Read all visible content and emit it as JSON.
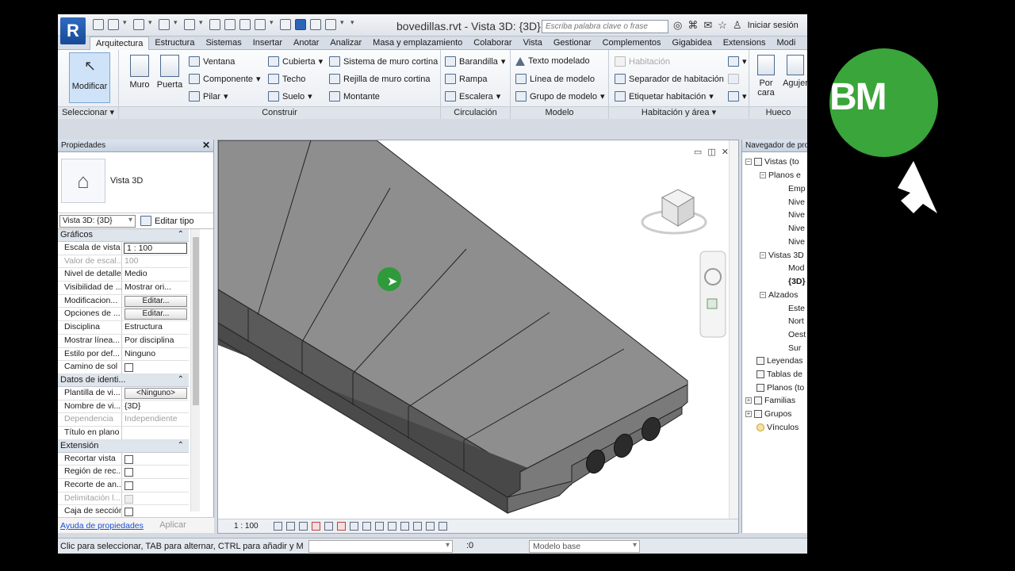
{
  "window": {
    "title": "bovedillas.rvt - Vista 3D: {3D}",
    "search_placeholder": "Escriba palabra clave o frase",
    "sign_in": "Iniciar sesión"
  },
  "tabs": [
    "Arquitectura",
    "Estructura",
    "Sistemas",
    "Insertar",
    "Anotar",
    "Analizar",
    "Masa y emplazamiento",
    "Colaborar",
    "Vista",
    "Gestionar",
    "Complementos",
    "Gigabidea",
    "Extensions",
    "Modi"
  ],
  "ribbon": {
    "select": {
      "modify": "Modificar",
      "label": "Seleccionar ▾"
    },
    "build": {
      "label": "Construir",
      "wall": "Muro",
      "door": "Puerta",
      "window": "Ventana",
      "component": "Componente",
      "column": "Pilar",
      "roof": "Cubierta",
      "ceiling": "Techo",
      "floor": "Suelo",
      "curtain_system": "Sistema de muro cortina",
      "curtain_grid": "Rejilla de muro cortina",
      "mullion": "Montante"
    },
    "circulation": {
      "label": "Circulación",
      "railing": "Barandilla",
      "ramp": "Rampa",
      "stair": "Escalera"
    },
    "model": {
      "label": "Modelo",
      "model_text": "Texto modelado",
      "model_line": "Línea de modelo",
      "model_group": "Grupo de modelo"
    },
    "room_area": {
      "label": "Habitación y área ▾",
      "room": "Habitación",
      "separator": "Separador de habitación",
      "tag": "Etiquetar habitación"
    },
    "opening": {
      "label": "Hueco",
      "by_face_1": "Por",
      "by_face_2": "cara",
      "shaft": "Agujer"
    }
  },
  "properties": {
    "header": "Propiedades",
    "type_name": "Vista 3D",
    "view_selector": "Vista 3D: {3D}",
    "edit_type": "Editar tipo",
    "categories": {
      "graphics": "Gráficos",
      "identity": "Datos de identi...",
      "extents": "Extensión"
    },
    "graphics_rows": [
      {
        "key": "Escala de vista",
        "value": "1 : 100"
      },
      {
        "key": "Valor de escal...",
        "value": "100"
      },
      {
        "key": "Nivel de detalle",
        "value": "Medio"
      },
      {
        "key": "Visibilidad de ...",
        "value": "Mostrar ori..."
      },
      {
        "key": "Modificacion...",
        "value": "Editar..."
      },
      {
        "key": "Opciones de ...",
        "value": "Editar..."
      },
      {
        "key": "Disciplina",
        "value": "Estructura"
      },
      {
        "key": "Mostrar línea...",
        "value": "Por disciplina"
      },
      {
        "key": "Estilo por def...",
        "value": "Ninguno"
      },
      {
        "key": "Camino de sol",
        "value": ""
      }
    ],
    "identity_rows": [
      {
        "key": "Plantilla de vi...",
        "value": "<Ninguno>"
      },
      {
        "key": "Nombre de vi...",
        "value": "{3D}"
      },
      {
        "key": "Dependencia",
        "value": "Independiente"
      },
      {
        "key": "Título en plano",
        "value": ""
      }
    ],
    "extents_rows": [
      {
        "key": "Recortar vista",
        "value": ""
      },
      {
        "key": "Región de rec...",
        "value": ""
      },
      {
        "key": "Recorte de an...",
        "value": ""
      },
      {
        "key": "Delimitación l...",
        "value": ""
      },
      {
        "key": "Caja de sección",
        "value": ""
      }
    ],
    "help": "Ayuda de propiedades",
    "apply": "Aplicar"
  },
  "viewport": {
    "scale": "1 : 100",
    "controls": "▭ ◫ ✕"
  },
  "browser": {
    "header": "Navegador de pro",
    "items": [
      "Vistas (to",
      "Planos e",
      "Emp",
      "Nive",
      "Nive",
      "Nive",
      "Nive",
      "Vistas 3D",
      "Mod",
      "{3D}",
      "Alzados",
      "Este",
      "Nort",
      "Oest",
      "Sur",
      "Leyendas",
      "Tablas de",
      "Planos (to",
      "Familias",
      "Grupos",
      "Vínculos"
    ]
  },
  "status": {
    "text": "Clic para seleccionar, TAB para alternar, CTRL para añadir y M",
    "count": ":0",
    "model": "Modelo base"
  },
  "brand": {
    "text": "BM",
    "color": "#3aa53a"
  },
  "colors": {
    "accent": "#2b65b8",
    "highlight": "#2f9a3a"
  }
}
